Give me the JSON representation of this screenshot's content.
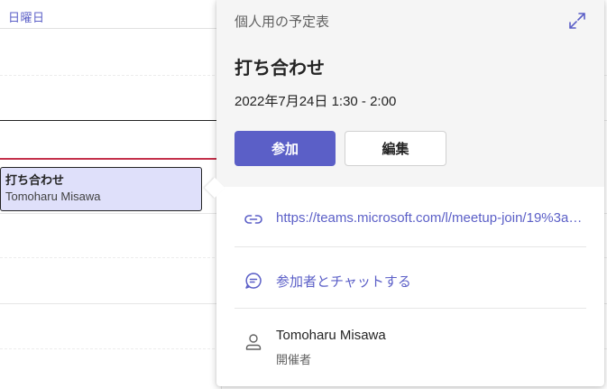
{
  "calendar": {
    "day_label": "日曜日",
    "event": {
      "title": "打ち合わせ",
      "organizer": "Tomoharu Misawa"
    }
  },
  "popover": {
    "calendar_name": "個人用の予定表",
    "title": "打ち合わせ",
    "time": "2022年7月24日 1:30 - 2:00",
    "join_label": "参加",
    "edit_label": "編集",
    "meeting_link": "https://teams.microsoft.com/l/meetup-join/19%3ameeting",
    "chat_label": "参加者とチャットする",
    "organizer": {
      "name": "Tomoharu Misawa",
      "role": "開催者"
    }
  },
  "icons": {
    "expand": "expand-icon",
    "link": "link-icon",
    "chat": "chat-icon",
    "person": "person-icon"
  },
  "colors": {
    "accent": "#5b5fc7",
    "event_fill": "#dfe0fa",
    "current_time_line": "#c4314b",
    "header_bg": "#f5f5f5"
  }
}
